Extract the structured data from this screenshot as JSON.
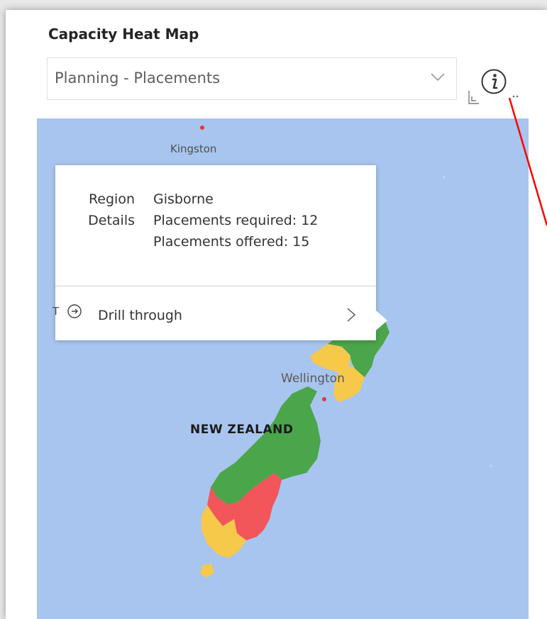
{
  "visual": {
    "title": "Capacity Heat Map",
    "dropdown": {
      "selected": "Planning - Placements"
    },
    "icons": [
      "chevron-down-icon",
      "info-icon",
      "focus-mode-icon",
      "more-options-icon"
    ]
  },
  "map": {
    "labels": {
      "kingston": "Kingston",
      "wellington": "Wellington",
      "new_zealand": "NEW ZEALAND"
    },
    "region_colors": {
      "green": "#4ba54a",
      "red": "#f2555a",
      "yellow": "#f6c94a",
      "water": "#a8c5ef"
    }
  },
  "tooltip": {
    "region_label": "Region",
    "region_value": "Gisborne",
    "details_label": "Details",
    "details_line1": "Placements required: 12",
    "details_line2": "Placements offered: 15",
    "drill_through_label": "Drill through"
  },
  "annotation": {
    "color": "#ff0000"
  }
}
